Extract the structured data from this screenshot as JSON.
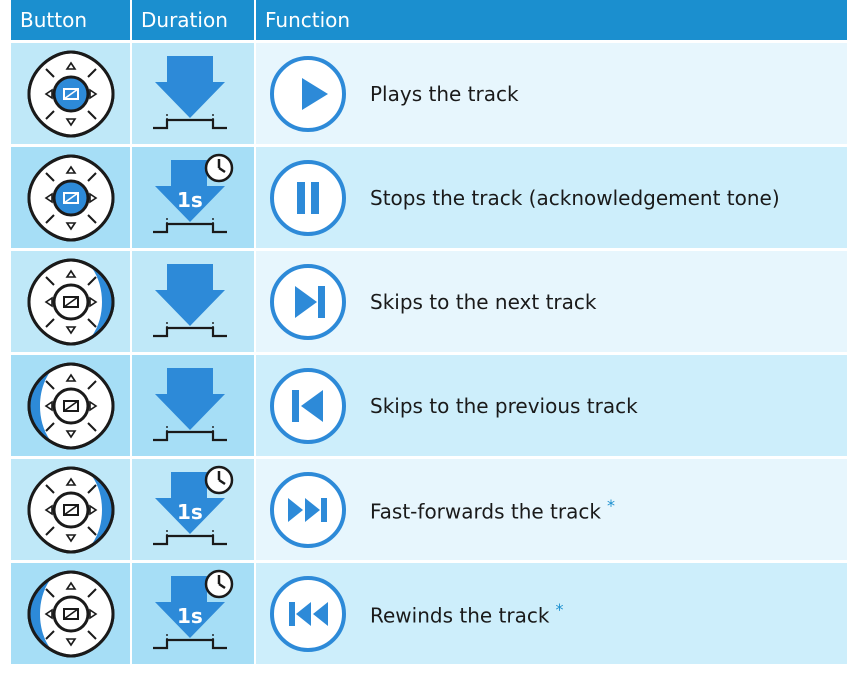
{
  "header": {
    "button_label": "Button",
    "duration_label": "Duration",
    "function_label": "Function"
  },
  "colors": {
    "header_bg": "#1b8fcf",
    "accent_blue": "#2d8ad8",
    "row_light": "#e7f6fd",
    "row_dark": "#cdeefb"
  },
  "rows": [
    {
      "button_press": "center",
      "duration": "short",
      "function_icon": "play-icon",
      "text": "Plays the track",
      "footnote": ""
    },
    {
      "button_press": "center",
      "duration": "long",
      "duration_label": "1s",
      "function_icon": "pause-icon",
      "text": "Stops the track (acknowledgement tone)",
      "footnote": ""
    },
    {
      "button_press": "right",
      "duration": "short",
      "function_icon": "next-track-icon",
      "text": "Skips to the next track",
      "footnote": ""
    },
    {
      "button_press": "left",
      "duration": "short",
      "function_icon": "previous-track-icon",
      "text": "Skips to the previous track",
      "footnote": ""
    },
    {
      "button_press": "right",
      "duration": "long",
      "duration_label": "1s",
      "function_icon": "fast-forward-icon",
      "text": "Fast-forwards the track",
      "footnote": "*"
    },
    {
      "button_press": "left",
      "duration": "long",
      "duration_label": "1s",
      "function_icon": "rewind-icon",
      "text": "Rewinds the track",
      "footnote": "*"
    }
  ]
}
